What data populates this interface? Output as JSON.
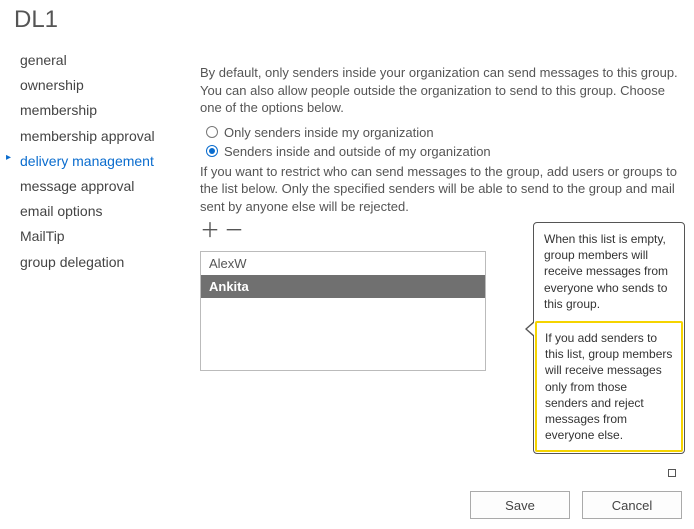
{
  "title": "DL1",
  "sidebar": {
    "items": [
      {
        "label": "general"
      },
      {
        "label": "ownership"
      },
      {
        "label": "membership"
      },
      {
        "label": "membership approval"
      },
      {
        "label": "delivery management",
        "active": true
      },
      {
        "label": "message approval"
      },
      {
        "label": "email options"
      },
      {
        "label": "MailTip"
      },
      {
        "label": "group delegation"
      }
    ]
  },
  "content": {
    "intro": "By default, only senders inside your organization can send messages to this group. You can also allow people outside the organization to send to this group. Choose one of the options below.",
    "radio1": "Only senders inside my organization",
    "radio2": "Senders inside and outside of my organization",
    "restrict": "If you want to restrict who can send messages to the group, add users or groups to the list below. Only the specified senders will be able to send to the group and mail sent by anyone else will be rejected.",
    "senders": [
      "AlexW",
      "Ankita"
    ],
    "selectedIndex": 1
  },
  "tooltip": {
    "top": "When this list is empty, group members will receive messages from everyone who sends to this group.",
    "bottom": "If you add senders to this list, group members will receive messages only from those senders and reject messages from everyone else."
  },
  "buttons": {
    "save": "Save",
    "cancel": "Cancel"
  },
  "icons": {
    "plus": "＋",
    "minus": "－"
  }
}
